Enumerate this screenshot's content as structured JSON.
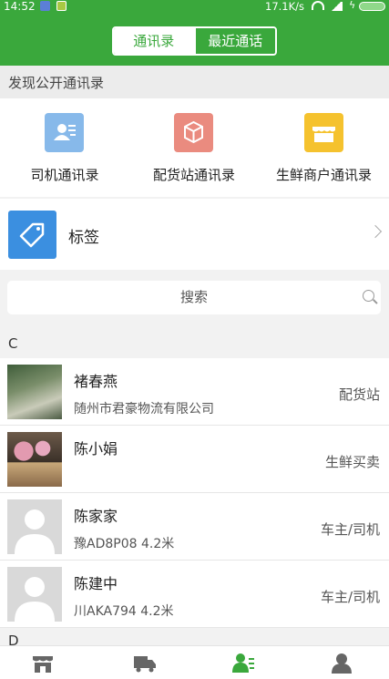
{
  "status_bar": {
    "time": "14:52",
    "speed": "17.1K/s"
  },
  "header": {
    "tabs": [
      {
        "label": "通讯录",
        "active": true
      },
      {
        "label": "最近通话",
        "active": false
      }
    ],
    "accent_color": "#3aa83c"
  },
  "discover": {
    "title": "发现公开通讯录",
    "categories": [
      {
        "label": "司机通讯录",
        "icon": "driver-card-icon"
      },
      {
        "label": "配货站通讯录",
        "icon": "package-icon"
      },
      {
        "label": "生鲜商户通讯录",
        "icon": "shop-icon"
      }
    ]
  },
  "tags": {
    "label": "标签",
    "icon": "tag-icon"
  },
  "search": {
    "placeholder": "搜索"
  },
  "groups": [
    {
      "letter": "C",
      "contacts": [
        {
          "name": "褚春燕",
          "sub": "随州市君豪物流有限公司",
          "role": "配货站",
          "avatar": "photo"
        },
        {
          "name": "陈小娟",
          "sub": "",
          "role": "生鲜买卖",
          "avatar": "photo"
        },
        {
          "name": "陈家家",
          "sub": "豫AD8P08 4.2米",
          "role": "车主/司机",
          "avatar": "default"
        },
        {
          "name": "陈建中",
          "sub": "川AKA794 4.2米",
          "role": "车主/司机",
          "avatar": "default"
        }
      ]
    },
    {
      "letter": "D",
      "contacts": []
    }
  ],
  "bottom_nav": [
    {
      "icon": "store-icon",
      "active": false
    },
    {
      "icon": "truck-icon",
      "active": false
    },
    {
      "icon": "contacts-icon",
      "active": true
    },
    {
      "icon": "user-icon",
      "active": false
    }
  ]
}
